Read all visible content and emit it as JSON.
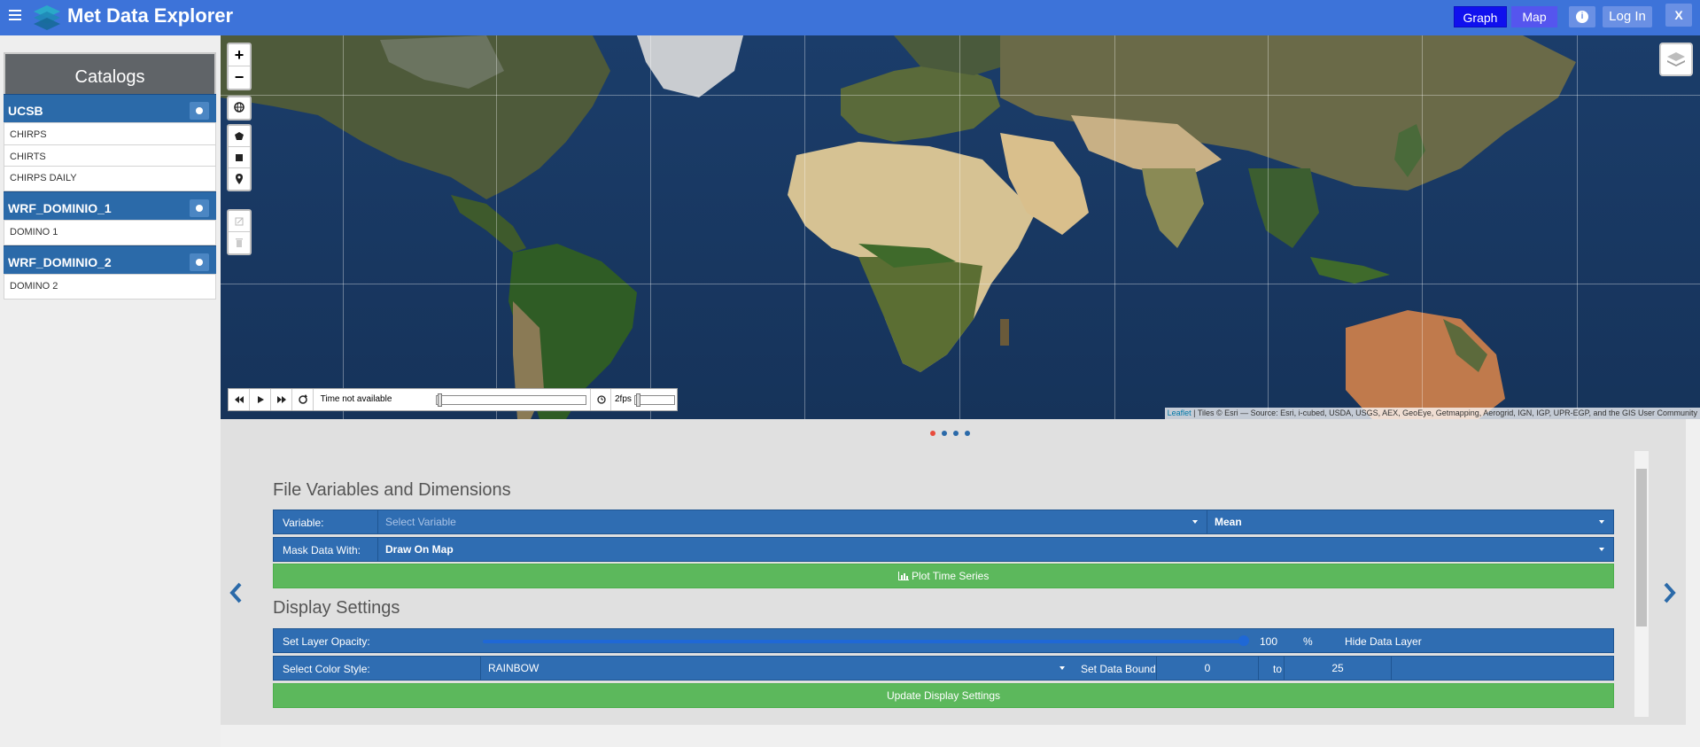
{
  "header": {
    "title": "Met Data Explorer",
    "graph_label": "Graph",
    "map_label": "Map",
    "info_label": "i",
    "login_label": "Log In",
    "close_label": "X"
  },
  "sidebar": {
    "heading": "Catalogs",
    "catalogs": [
      {
        "name": "UCSB",
        "items": [
          "CHIRPS",
          "CHIRTS",
          "CHIRPS DAILY"
        ]
      },
      {
        "name": "WRF_DOMINIO_1",
        "items": [
          "DOMINO 1"
        ]
      },
      {
        "name": "WRF_DOMINIO_2",
        "items": [
          "DOMINO 2"
        ]
      }
    ]
  },
  "map": {
    "zoom_in": "+",
    "zoom_out": "−",
    "time_label": "Time not available",
    "fps_label": "2fps",
    "attribution_leaflet": "Leaflet",
    "attribution_text": " | Tiles © Esri — Source: Esri, i-cubed, USDA, USGS, AEX, GeoEye, Getmapping, Aerogrid, IGN, IGP, UPR-EGP, and the GIS User Community"
  },
  "panel": {
    "carousel_dots": 4,
    "active_dot": 0,
    "file_section": {
      "title": "File Variables and Dimensions",
      "variable_label": "Variable:",
      "variable_placeholder": "Select Variable",
      "stat_value": "Mean",
      "mask_label": "Mask Data With:",
      "mask_value": "Draw On Map",
      "plot_button": "Plot Time Series"
    },
    "display_section": {
      "title": "Display Settings",
      "opacity_label": "Set Layer Opacity:",
      "opacity_value": "100",
      "opacity_unit": "%",
      "hide_layer_label": "Hide Data Layer",
      "color_label": "Select Color Style:",
      "color_value": "RAINBOW",
      "bounds_label": "Set Data Bounds:",
      "bounds_min": "0",
      "bounds_to": "to",
      "bounds_max": "25",
      "update_button": "Update Display Settings"
    }
  },
  "colors": {
    "header_bg": "#3d73d9",
    "catalog_header": "#2b6aa9",
    "row_blue": "#2f6db2",
    "green_button": "#5cb85c",
    "graph_button": "#1010ee",
    "map_button": "#5555ee",
    "active_dot": "#e84c3d"
  }
}
